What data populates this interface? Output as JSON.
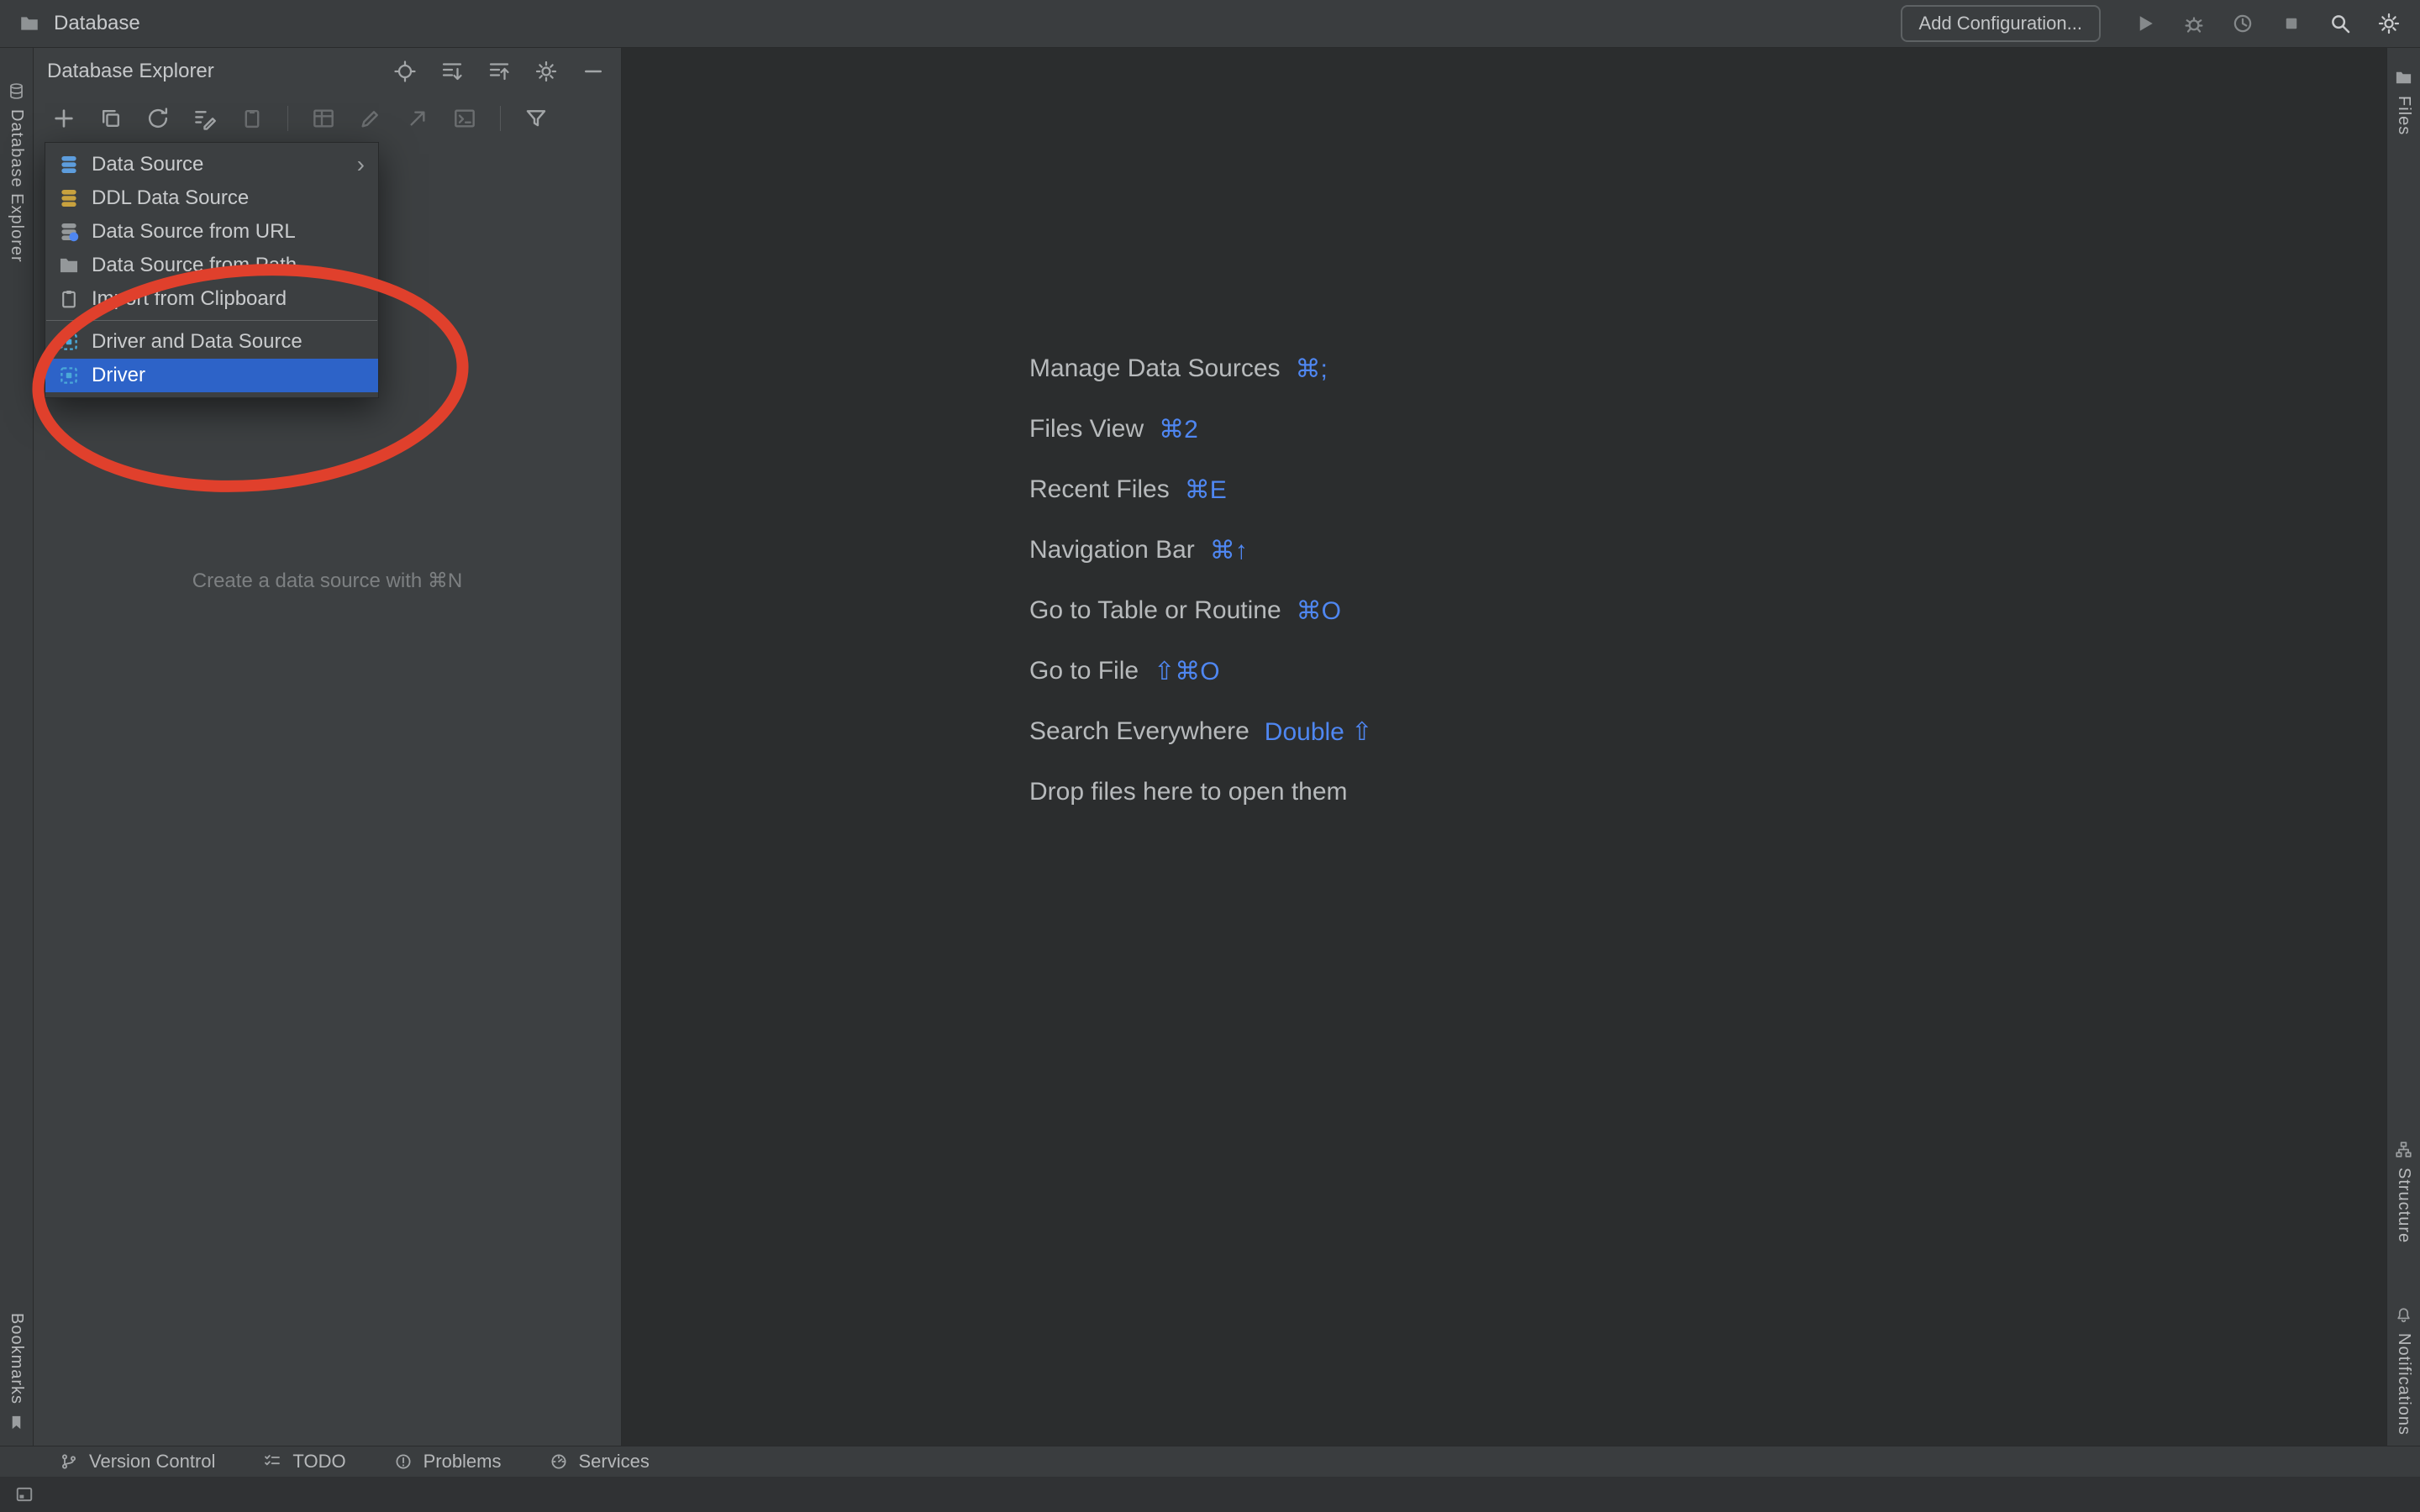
{
  "titlebar": {
    "project": "Database",
    "add_configuration": "Add Configuration...",
    "actions": [
      {
        "icon": "run"
      },
      {
        "icon": "debug"
      },
      {
        "icon": "profiler"
      },
      {
        "icon": "stop"
      },
      {
        "icon": "search",
        "bright": true
      },
      {
        "icon": "settings",
        "bright": true
      }
    ]
  },
  "left_stripe": {
    "top_label": "Database Explorer",
    "bottom_label": "Bookmarks"
  },
  "right_stripe": {
    "top_label": "Files",
    "middle_label": "Structure",
    "bottom_label": "Notifications"
  },
  "explorer": {
    "title": "Database Explorer",
    "header_actions": [
      "locate",
      "expand-all",
      "collapse-all",
      "settings",
      "hide"
    ],
    "toolbar": [
      {
        "icon": "add"
      },
      {
        "icon": "duplicate"
      },
      {
        "icon": "refresh"
      },
      {
        "icon": "data-source-properties"
      },
      {
        "icon": "paste",
        "dim": true
      },
      {
        "sep": true
      },
      {
        "icon": "table",
        "dim": true
      },
      {
        "icon": "edit",
        "dim": true
      },
      {
        "icon": "jump-to",
        "dim": true
      },
      {
        "icon": "console",
        "dim": true
      },
      {
        "sep": true
      },
      {
        "icon": "filter"
      }
    ],
    "empty_hint": "Create a data source with ⌘N"
  },
  "menu": {
    "items": [
      {
        "label": "Data Source",
        "icon": "data-source",
        "submenu": true
      },
      {
        "label": "DDL Data Source",
        "icon": "ddl-data-source"
      },
      {
        "label": "Data Source from URL",
        "icon": "data-source-url"
      },
      {
        "label": "Data Source from Path",
        "icon": "data-source-path"
      },
      {
        "label": "Import from Clipboard",
        "icon": "clipboard"
      },
      {
        "separator": true
      },
      {
        "label": "Driver and Data Source",
        "icon": "driver-and-data-source"
      },
      {
        "label": "Driver",
        "icon": "driver",
        "selected": true
      }
    ]
  },
  "shortcuts": [
    {
      "label": "Manage Data Sources",
      "keys": "⌘;"
    },
    {
      "label": "Files View",
      "keys": "⌘2"
    },
    {
      "label": "Recent Files",
      "keys": "⌘E"
    },
    {
      "label": "Navigation Bar",
      "keys": "⌘↑"
    },
    {
      "label": "Go to Table or Routine",
      "keys": "⌘O"
    },
    {
      "label": "Go to File",
      "keys": "⇧⌘O"
    },
    {
      "label": "Search Everywhere",
      "keys": "Double ⇧"
    },
    {
      "label": "Drop files here to open them",
      "keys": ""
    }
  ],
  "bottom_stripe": [
    {
      "label": "Version Control",
      "icon": "version-control"
    },
    {
      "label": "TODO",
      "icon": "todo"
    },
    {
      "label": "Problems",
      "icon": "problems"
    },
    {
      "label": "Services",
      "icon": "services"
    }
  ],
  "colors": {
    "selection": "#2d63c8",
    "shortcut_key": "#4f87f2",
    "annotation": "#e0402c"
  }
}
